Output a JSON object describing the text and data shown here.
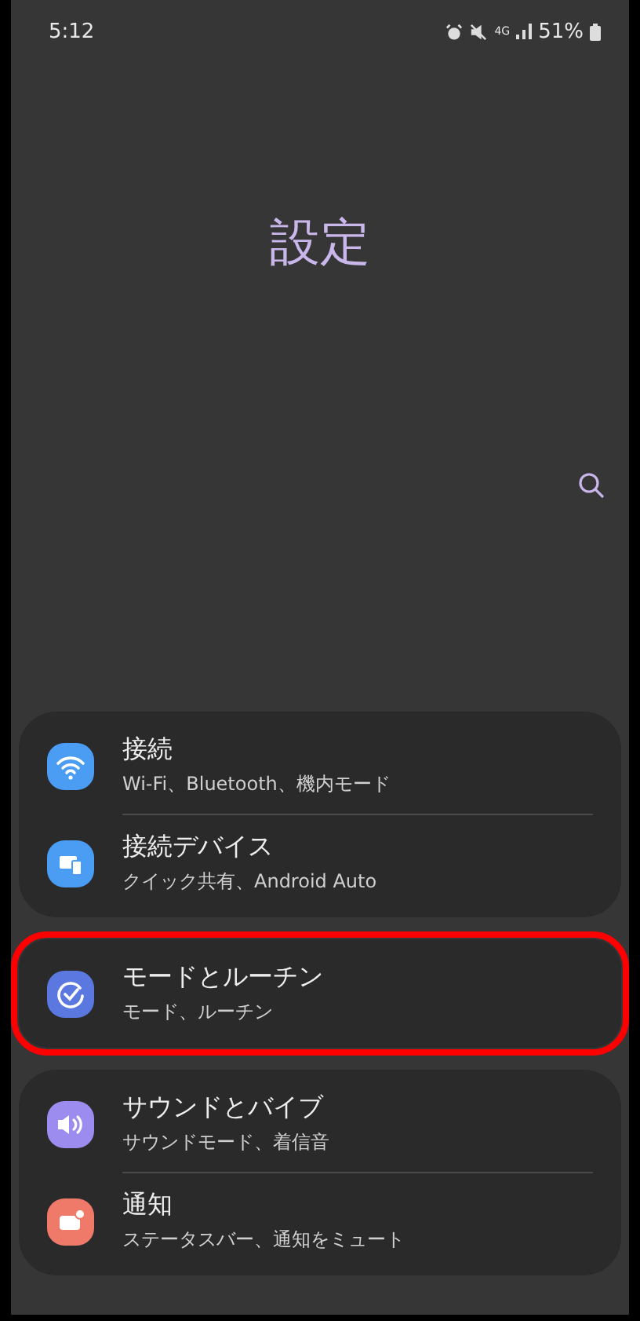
{
  "status_bar": {
    "time": "5:12",
    "network": "4G",
    "battery": "51%"
  },
  "title": "設定",
  "groups": [
    {
      "highlighted": false,
      "items": [
        {
          "kind": "wifi",
          "color": "#4a9df2",
          "title": "接続",
          "subtitle": "Wi-Fi、Bluetooth、機内モード"
        },
        {
          "kind": "devices",
          "color": "#4a9df2",
          "title": "接続デバイス",
          "subtitle": "クイック共有、Android Auto"
        }
      ]
    },
    {
      "highlighted": true,
      "items": [
        {
          "kind": "routine",
          "color": "#5a78e0",
          "title": "モードとルーチン",
          "subtitle": "モード、ルーチン"
        }
      ]
    },
    {
      "highlighted": false,
      "items": [
        {
          "kind": "sound",
          "color": "#9c8cf0",
          "title": "サウンドとバイブ",
          "subtitle": "サウンドモード、着信音"
        },
        {
          "kind": "notification",
          "color": "#f07a6a",
          "title": "通知",
          "subtitle": "ステータスバー、通知をミュート"
        }
      ]
    }
  ]
}
